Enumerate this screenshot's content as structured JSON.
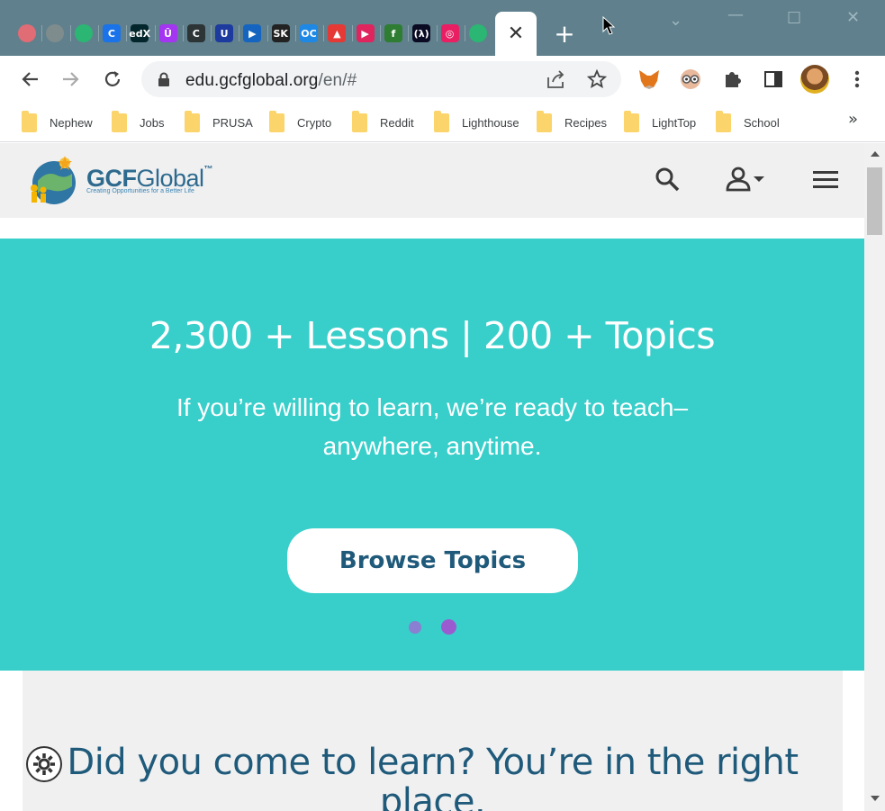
{
  "browser": {
    "tabs": [
      {
        "icon": "record-icon",
        "color": "#e06c75"
      },
      {
        "icon": "chrome-icon",
        "color": "#7f8c8d"
      },
      {
        "icon": "sprout-icon",
        "color": "#2bb673"
      },
      {
        "icon": "c-icon",
        "color": "#1a73e8",
        "glyph": "C"
      },
      {
        "icon": "edx-icon",
        "color": "#02262b",
        "glyph": "edX"
      },
      {
        "icon": "u-icon",
        "color": "#a435f0",
        "glyph": "Û"
      },
      {
        "icon": "c-outline-icon",
        "color": "#2d3436",
        "glyph": "C"
      },
      {
        "icon": "udacity-icon",
        "color": "#1d3a9e",
        "glyph": "U"
      },
      {
        "icon": "play-icon",
        "color": "#1565c0",
        "glyph": "▶"
      },
      {
        "icon": "sk-icon",
        "color": "#222222",
        "glyph": "SK"
      },
      {
        "icon": "oc-icon",
        "color": "#1e88e5",
        "glyph": "OC"
      },
      {
        "icon": "triangles-icon",
        "color": "#e53935",
        "glyph": "▲"
      },
      {
        "icon": "play-circle-icon",
        "color": "#e0245e",
        "glyph": "▶"
      },
      {
        "icon": "f-icon",
        "color": "#2e7d32",
        "glyph": "f"
      },
      {
        "icon": "freecodecamp-icon",
        "color": "#0a0a23",
        "glyph": "(λ)"
      },
      {
        "icon": "swirl-icon",
        "color": "#e91e63",
        "glyph": "◎"
      },
      {
        "icon": "sprout-icon",
        "color": "#2bb673"
      }
    ],
    "url_host": "edu.gcfglobal.org",
    "url_path": "/en/#",
    "bookmarks": [
      "Nephew",
      "Jobs",
      "PRUSA",
      "Crypto",
      "Reddit",
      "Lighthouse",
      "Recipes",
      "LightTop",
      "School"
    ],
    "bookmarks_more": "»"
  },
  "site": {
    "logo_bold": "GCF",
    "logo_thin": "Global",
    "logo_tm": "™",
    "tagline": "Creating Opportunities for a Better Life"
  },
  "hero": {
    "title": "2,300 + Lessons | 200 + Topics",
    "subtitle": "If you’re willing to learn, we’re ready to teach–anywhere, anytime.",
    "button": "Browse Topics",
    "carousel_active_index": 1,
    "dot_colors": [
      "#8a7fd0",
      "#9b5bd0"
    ]
  },
  "learn": {
    "heading": "Did you come to learn? You’re in the right place."
  },
  "colors": {
    "hero_bg": "#38ceca",
    "brand_blue": "#1f5a7a",
    "tabstrip": "#5f808c"
  }
}
